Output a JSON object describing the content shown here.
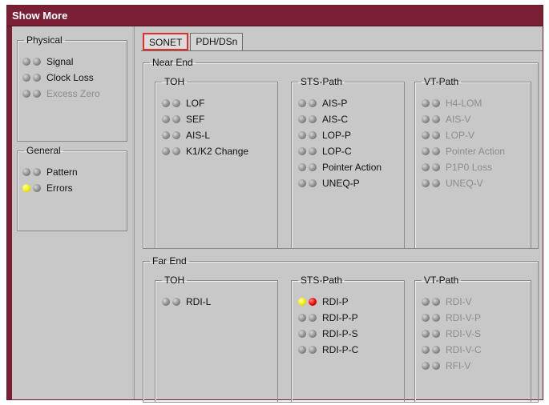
{
  "window": {
    "title": "Show More"
  },
  "tabs": [
    {
      "label": "SONET",
      "active": true
    },
    {
      "label": "PDH/DSn",
      "active": false
    }
  ],
  "physical": {
    "title": "Physical",
    "items": [
      {
        "label": "Signal",
        "leds": [
          "gray",
          "gray"
        ],
        "enabled": true
      },
      {
        "label": "Clock Loss",
        "leds": [
          "gray",
          "gray"
        ],
        "enabled": true
      },
      {
        "label": "Excess Zero",
        "leds": [
          "gray",
          "gray"
        ],
        "enabled": false
      }
    ]
  },
  "general": {
    "title": "General",
    "items": [
      {
        "label": "Pattern",
        "leds": [
          "gray",
          "gray"
        ],
        "enabled": true
      },
      {
        "label": "Errors",
        "leds": [
          "yellow",
          "gray"
        ],
        "enabled": true
      }
    ]
  },
  "near_end": {
    "title": "Near End",
    "toh": {
      "title": "TOH",
      "items": [
        {
          "label": "LOF",
          "leds": [
            "gray",
            "gray"
          ],
          "enabled": true
        },
        {
          "label": "SEF",
          "leds": [
            "gray",
            "gray"
          ],
          "enabled": true
        },
        {
          "label": "AIS-L",
          "leds": [
            "gray",
            "gray"
          ],
          "enabled": true
        },
        {
          "label": "K1/K2 Change",
          "leds": [
            "gray",
            "gray"
          ],
          "enabled": true
        }
      ]
    },
    "sts_path": {
      "title": "STS-Path",
      "items": [
        {
          "label": "AIS-P",
          "leds": [
            "gray",
            "gray"
          ],
          "enabled": true
        },
        {
          "label": "AIS-C",
          "leds": [
            "gray",
            "gray"
          ],
          "enabled": true
        },
        {
          "label": "LOP-P",
          "leds": [
            "gray",
            "gray"
          ],
          "enabled": true
        },
        {
          "label": "LOP-C",
          "leds": [
            "gray",
            "gray"
          ],
          "enabled": true
        },
        {
          "label": "Pointer Action",
          "leds": [
            "gray",
            "gray"
          ],
          "enabled": true
        },
        {
          "label": "UNEQ-P",
          "leds": [
            "gray",
            "gray"
          ],
          "enabled": true
        }
      ]
    },
    "vt_path": {
      "title": "VT-Path",
      "items": [
        {
          "label": "H4-LOM",
          "leds": [
            "gray",
            "gray"
          ],
          "enabled": false
        },
        {
          "label": "AIS-V",
          "leds": [
            "gray",
            "gray"
          ],
          "enabled": false
        },
        {
          "label": "LOP-V",
          "leds": [
            "gray",
            "gray"
          ],
          "enabled": false
        },
        {
          "label": "Pointer Action",
          "leds": [
            "gray",
            "gray"
          ],
          "enabled": false
        },
        {
          "label": "P1P0 Loss",
          "leds": [
            "gray",
            "gray"
          ],
          "enabled": false
        },
        {
          "label": "UNEQ-V",
          "leds": [
            "gray",
            "gray"
          ],
          "enabled": false
        }
      ]
    }
  },
  "far_end": {
    "title": "Far End",
    "toh": {
      "title": "TOH",
      "items": [
        {
          "label": "RDI-L",
          "leds": [
            "gray",
            "gray"
          ],
          "enabled": true
        }
      ]
    },
    "sts_path": {
      "title": "STS-Path",
      "items": [
        {
          "label": "RDI-P",
          "leds": [
            "yellow",
            "red"
          ],
          "enabled": true
        },
        {
          "label": "RDI-P-P",
          "leds": [
            "gray",
            "gray"
          ],
          "enabled": true
        },
        {
          "label": "RDI-P-S",
          "leds": [
            "gray",
            "gray"
          ],
          "enabled": true
        },
        {
          "label": "RDI-P-C",
          "leds": [
            "gray",
            "gray"
          ],
          "enabled": true
        }
      ]
    },
    "vt_path": {
      "title": "VT-Path",
      "items": [
        {
          "label": "RDI-V",
          "leds": [
            "gray",
            "gray"
          ],
          "enabled": false
        },
        {
          "label": "RDI-V-P",
          "leds": [
            "gray",
            "gray"
          ],
          "enabled": false
        },
        {
          "label": "RDI-V-S",
          "leds": [
            "gray",
            "gray"
          ],
          "enabled": false
        },
        {
          "label": "RDI-V-C",
          "leds": [
            "gray",
            "gray"
          ],
          "enabled": false
        },
        {
          "label": "RFI-V",
          "leds": [
            "gray",
            "gray"
          ],
          "enabled": false
        }
      ]
    }
  }
}
